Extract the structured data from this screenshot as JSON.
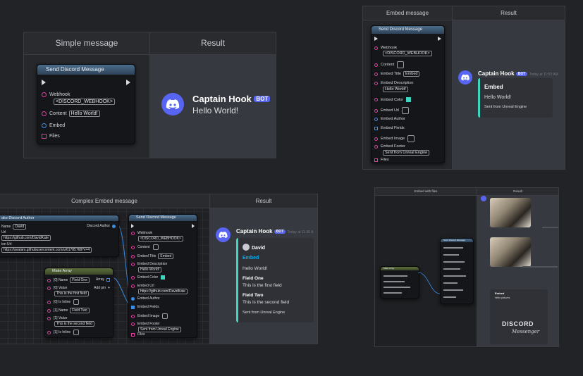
{
  "panels": {
    "simple": {
      "left_header": "Simple message",
      "right_header": "Result",
      "node": {
        "title": "Send Discord Message",
        "pins": [
          {
            "label": "Webhook",
            "value": "<DISCORD_WEBHOOK>"
          },
          {
            "label": "Content",
            "value": "Hello World!"
          },
          {
            "label": "Embed"
          },
          {
            "label": "Files"
          }
        ]
      },
      "result": {
        "name": "Captain Hook",
        "badge": "BOT",
        "message": "Hello World!"
      }
    },
    "embed": {
      "left_header": "Embed message",
      "right_header": "Result",
      "node": {
        "title": "Send Discord Message",
        "pins": [
          {
            "label": "Webhook",
            "value": "<DISCORD_WEBHOOK>"
          },
          {
            "label": "Content"
          },
          {
            "label": "Embed Title",
            "value": "Embed"
          },
          {
            "label": "Embed Description",
            "value": "Hello World!"
          },
          {
            "label": "Embed Color"
          },
          {
            "label": "Embed Url"
          },
          {
            "label": "Embed Author"
          },
          {
            "label": "Embed Fields"
          },
          {
            "label": "Embed Image"
          },
          {
            "label": "Embed Footer",
            "value": "Sent from Unreal Engine"
          },
          {
            "label": "Files"
          }
        ]
      },
      "result": {
        "name": "Captain Hook",
        "badge": "BOT",
        "time": "Today at 11:53 AM",
        "embed_title": "Embed",
        "embed_desc": "Hello World!",
        "embed_footer": "Sent from Unreal Engine"
      }
    },
    "complex": {
      "left_header": "Complex Embed message",
      "right_header": "Result",
      "author_node": {
        "title": "ake Discord Author",
        "pins": [
          {
            "label": "Name",
            "value": "David"
          },
          {
            "label": "Url",
            "value": "https://github.com/DavidKate"
          },
          {
            "label": "ion Url",
            "value": "https://avatars.githubusercontent.com/u/61785768?v=4"
          }
        ],
        "output": "Discord Author"
      },
      "array_node": {
        "title": "Make Array",
        "output": "Array",
        "add_pin": "Add pin",
        "pins": [
          {
            "label": "[0] Name",
            "value": "Field One"
          },
          {
            "label": "[0] Value",
            "value": "This is the first field"
          },
          {
            "label": "[0] Is Inline"
          },
          {
            "label": "[1] Name",
            "value": "Field Two"
          },
          {
            "label": "[1] Value",
            "value": "This is the second field"
          },
          {
            "label": "[1] Is Inline"
          }
        ]
      },
      "send_node": {
        "title": "Send Discord Message",
        "pins": [
          {
            "label": "Webhook",
            "value": "<DISCORD_WEBHOOK>"
          },
          {
            "label": "Content"
          },
          {
            "label": "Embed Title",
            "value": "Embed"
          },
          {
            "label": "Embed Description",
            "value": "Hello World!"
          },
          {
            "label": "Embed Color"
          },
          {
            "label": "Embed Url",
            "value": "https://github.com/DavidKate"
          },
          {
            "label": "Embed Author"
          },
          {
            "label": "Embed Fields"
          },
          {
            "label": "Embed Image"
          },
          {
            "label": "Embed Footer",
            "value": "Sent from Unreal Engine"
          },
          {
            "label": "Files"
          }
        ]
      },
      "result": {
        "name": "Captain Hook",
        "badge": "BOT",
        "time": "Today at 11:36 A",
        "author": "David",
        "embed_title": "Embed",
        "embed_desc": "Hello World!",
        "field1_name": "Field One",
        "field1_value": "This is the first field",
        "field2_name": "Field Two",
        "field2_value": "This is the second field",
        "footer": "Sent from Unreal Engine"
      }
    },
    "files": {
      "left_header": "Embed with files",
      "right_header": "Result",
      "small_node_title": "Make Array",
      "send_node_title": "Send Discord Message",
      "embed_title": "Embed",
      "embed_desc": "Hello pictures",
      "logo_top": "DISCORD",
      "logo_bottom": "Messenger"
    }
  },
  "colors": {
    "accent": "#5865f2",
    "embed_border": "#3fd6c0",
    "pin": "#e23fa0",
    "pin_blue": "#3b8fe6"
  }
}
